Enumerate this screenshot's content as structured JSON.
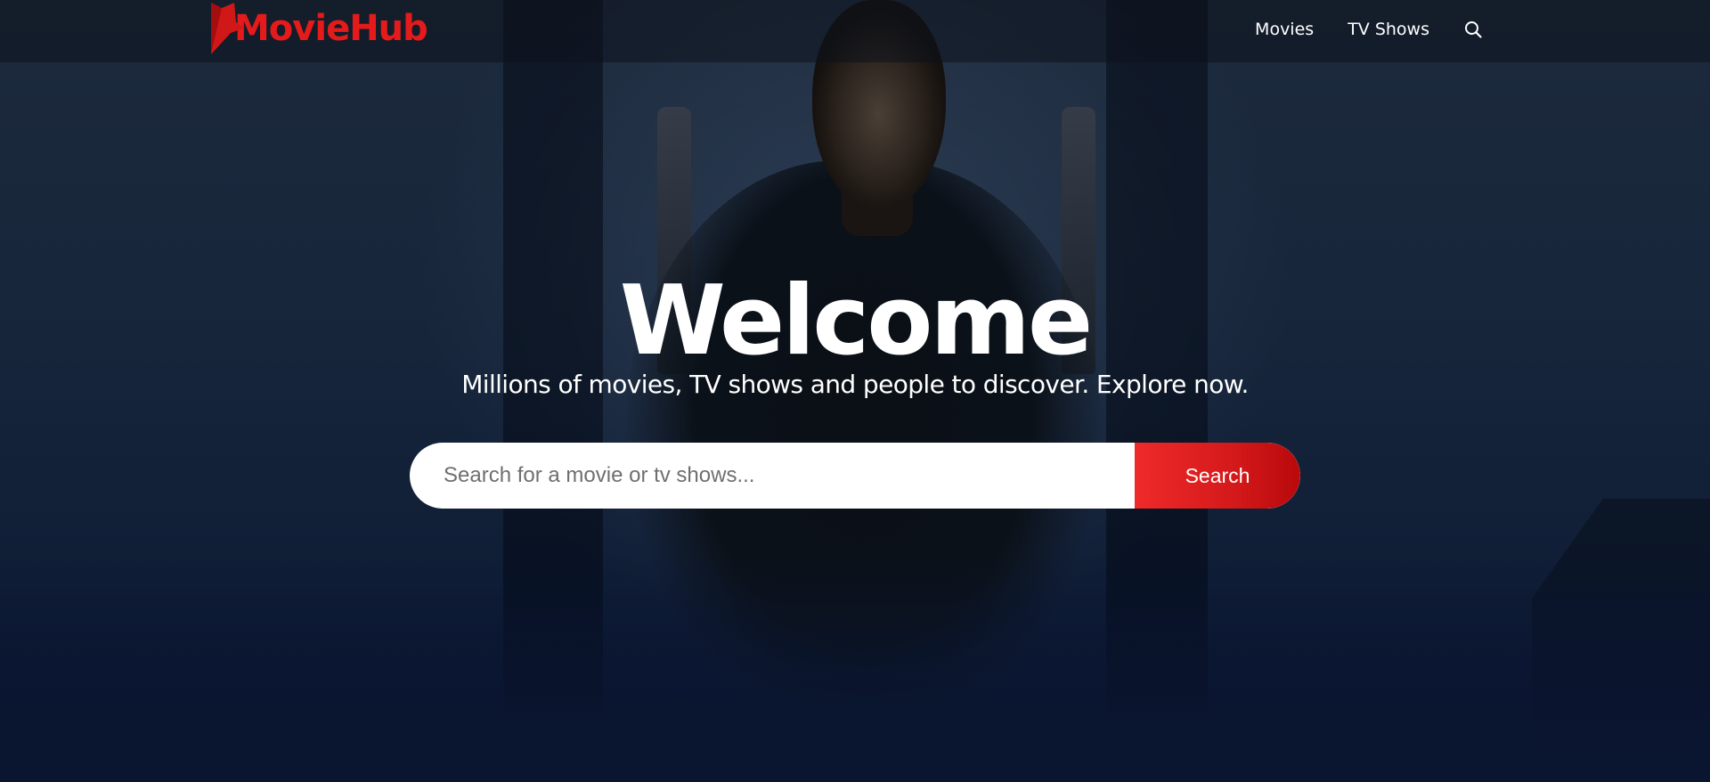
{
  "header": {
    "logo_text": "MovieHub",
    "logo_initial": "M",
    "brand_color": "#e51b1b",
    "nav": [
      {
        "label": "Movies"
      },
      {
        "label": "TV Shows"
      }
    ],
    "search_icon": "search-icon"
  },
  "hero": {
    "title": "Welcome",
    "subtitle": "Millions of movies, TV shows and people to discover. Explore now.",
    "search": {
      "placeholder": "Search for a movie or tv shows...",
      "value": "",
      "button_label": "Search"
    },
    "background_image": "movie-poster-backdrop"
  }
}
